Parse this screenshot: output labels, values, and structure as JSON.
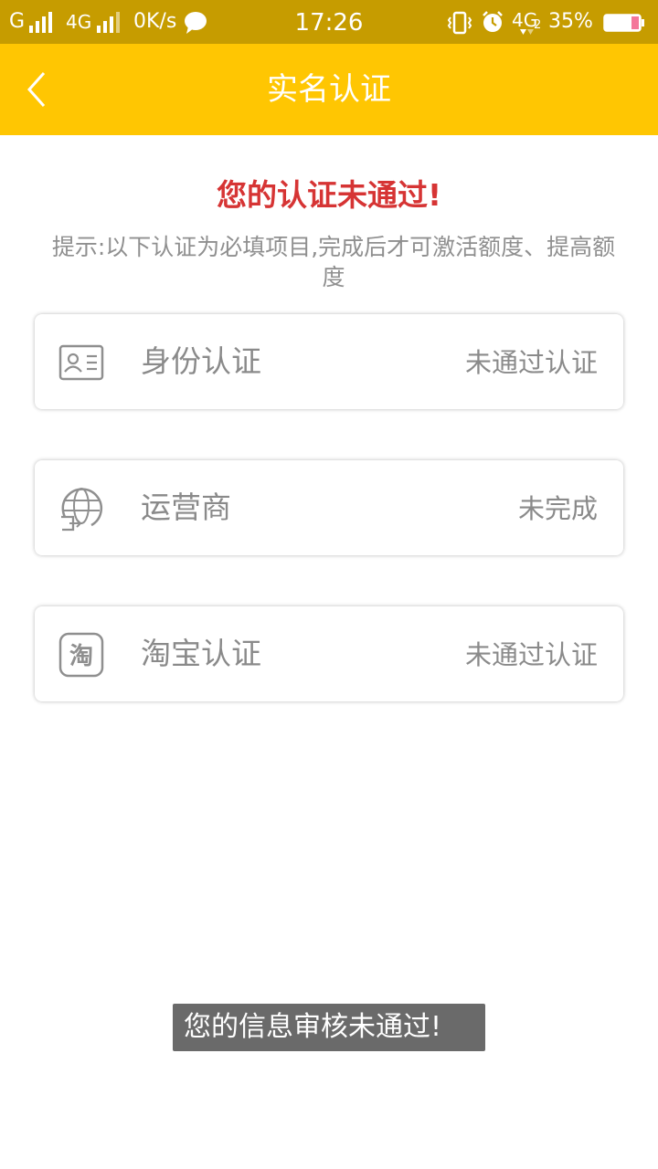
{
  "status_bar": {
    "carrier1": "G",
    "carrier2": "4G",
    "net_speed": "0K/s",
    "time": "17:26",
    "network_type": "4G",
    "network_sub": "2",
    "battery_percent": "35%",
    "battery_level": 0.35,
    "icons": [
      "signal-icon",
      "signal-icon",
      "chat-bubble-icon",
      "vibrate-icon",
      "alarm-icon",
      "battery-icon"
    ]
  },
  "nav": {
    "back_icon": "chevron-left-icon",
    "title": "实名认证"
  },
  "alert": {
    "title": "您的认证未通过!",
    "hint": "提示:以下认证为必填项目,完成后才可激活额度、提高额度"
  },
  "items": [
    {
      "icon": "id-card-icon",
      "label": "身份认证",
      "status": "未通过认证"
    },
    {
      "icon": "carrier-globe-icon",
      "label": "运营商",
      "status": "未完成"
    },
    {
      "icon": "taobao-icon",
      "label": "淘宝认证",
      "status": "未通过认证",
      "icon_text": "淘"
    }
  ],
  "toast": {
    "text": "您的信息审核未通过!"
  },
  "colors": {
    "status_bar_bg": "#c69c00",
    "nav_bg": "#ffc602",
    "alert_red": "#d63434",
    "gray_text": "#8a8a8a"
  }
}
